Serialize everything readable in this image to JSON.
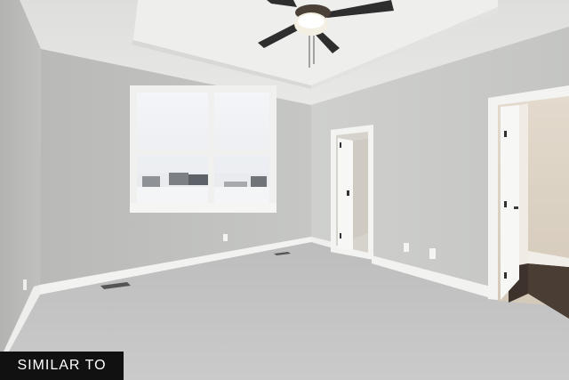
{
  "watermark": {
    "text": "SIMILAR TO"
  },
  "palette": {
    "wall_left": "#bdbdbb",
    "wall_back": "#c3c4c2",
    "wall_right": "#c9cac8",
    "ceiling": "#e4e4e2",
    "tray_ceiling": "#ededeb",
    "carpet": "#c4c4c4",
    "trim": "#f2f2f0",
    "closet_interior": "#d9d6cf",
    "bathroom_wall": "#dcd2c4",
    "bathroom_floor": "#4a3d34",
    "window_glass": "#f5f7fa",
    "fan_blade": "#2e2e2e"
  },
  "objects": [
    "ceiling-fan",
    "window",
    "closet-door",
    "bathroom-door",
    "carpet",
    "floor-vents",
    "wall-outlets"
  ]
}
